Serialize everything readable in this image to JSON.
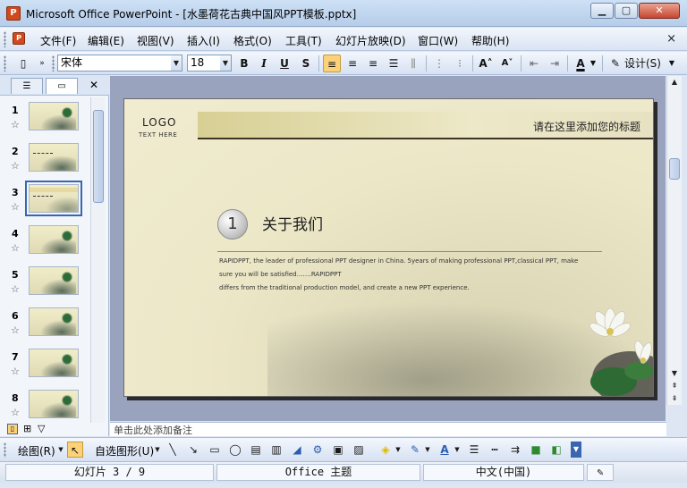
{
  "window": {
    "app_icon": "powerpoint-icon",
    "title": "Microsoft Office PowerPoint - [水墨荷花古典中国风PPT模板.pptx]",
    "minimize": "▁",
    "maximize": "▢",
    "close": "✕"
  },
  "menu": {
    "items": [
      "文件(F)",
      "编辑(E)",
      "视图(V)",
      "插入(I)",
      "格式(O)",
      "工具(T)",
      "幻灯片放映(D)",
      "窗口(W)",
      "帮助(H)"
    ],
    "close_doc": "×"
  },
  "toolbar": {
    "font_name": "宋体",
    "font_size": "18",
    "bold": "B",
    "italic": "I",
    "underline": "U",
    "shadow": "S",
    "font_color": "A",
    "design_label": "设计(S)"
  },
  "left_pane": {
    "slides": [
      {
        "num": "1",
        "star": "☆"
      },
      {
        "num": "2",
        "star": "☆"
      },
      {
        "num": "3",
        "star": "☆"
      },
      {
        "num": "4",
        "star": "☆"
      },
      {
        "num": "5",
        "star": "☆"
      },
      {
        "num": "6",
        "star": "☆"
      },
      {
        "num": "7",
        "star": "☆"
      },
      {
        "num": "8",
        "star": "☆"
      }
    ],
    "selected_index": 3,
    "close": "✕"
  },
  "slide": {
    "logo": "LOGO",
    "logo_sub": "TEXT HERE",
    "header_title": "请在这里添加您的标题",
    "number": "1",
    "heading": "关于我们",
    "body_line1": "RAPIDPPT, the leader of professional PPT designer in China. 5years of making professional PPT,classical PPT, make",
    "body_line2": "sure you will be satisfied.……RAPIDPPT",
    "body_line3": "differs from the traditional production model, and create a new PPT experience."
  },
  "notes": {
    "text": "单击此处添加备注"
  },
  "draw_toolbar": {
    "draw_label": "绘图(R)",
    "autoshape_label": "自选图形(U)"
  },
  "status": {
    "slide_info": "幻灯片 3 / 9",
    "theme": "Office 主题",
    "language": "中文(中国)"
  },
  "colors": {
    "accent": "#fbd27a",
    "selection": "#3a66b0",
    "chrome": "#dae4f3"
  }
}
